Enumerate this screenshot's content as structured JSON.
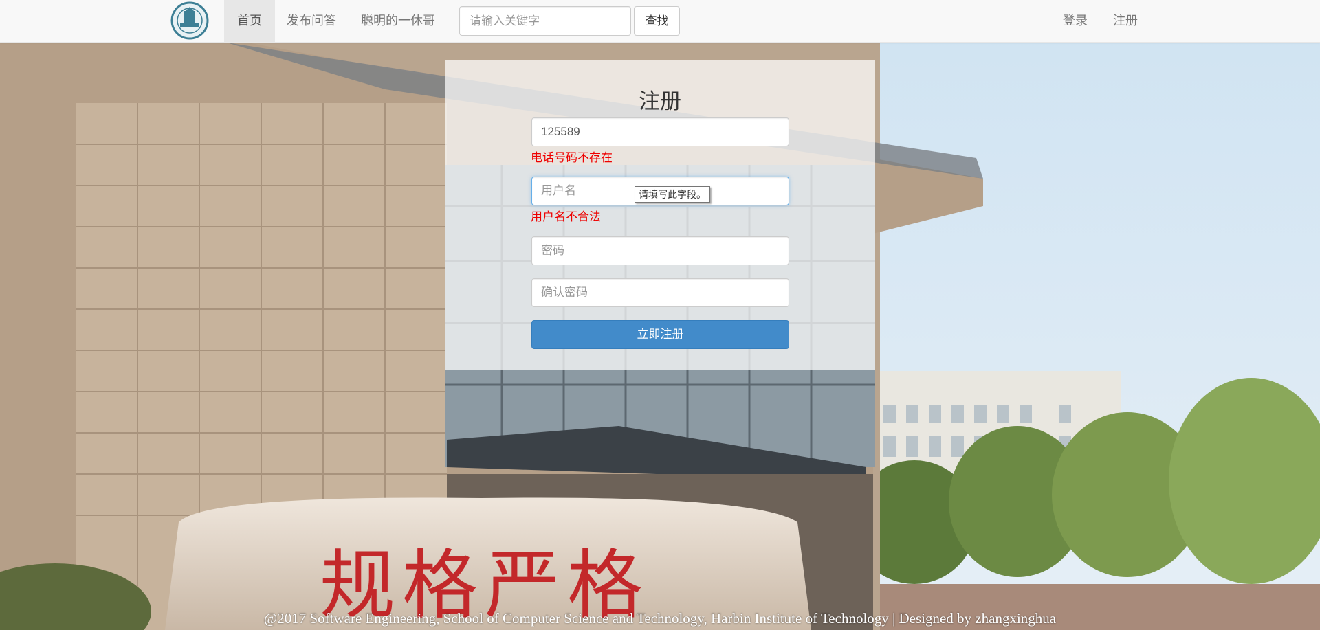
{
  "navbar": {
    "home_label": "首页",
    "ask_label": "发布问答",
    "user_label": "聪明的一休哥",
    "search_placeholder": "请输入关键字",
    "search_button": "查找",
    "login_label": "登录",
    "register_label": "注册",
    "logo_icon": "university-seal-icon"
  },
  "register_form": {
    "title": "注册",
    "phone_value": "125589",
    "phone_error": "电话号码不存在",
    "username_placeholder": "用户名",
    "username_error": "用户名不合法",
    "validation_tooltip": "请填写此字段。",
    "password_placeholder": "密码",
    "confirm_placeholder": "确认密码",
    "submit_label": "立即注册"
  },
  "stone_inscription": "规格严格",
  "footer": {
    "text": "@2017 Software Engineering, School of Computer Science and Technology, Harbin Institute of Technology | Designed by zhangxinghua"
  },
  "colors": {
    "primary": "#428bca",
    "error": "#ee0000",
    "navbar_bg": "#f8f8f8"
  }
}
